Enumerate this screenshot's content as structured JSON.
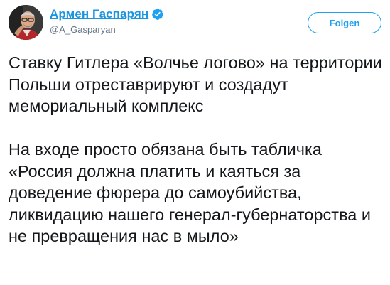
{
  "user": {
    "display_name": "Армен Гаспарян",
    "handle": "@A_Gasparyan",
    "verified": true,
    "avatar_icon": "profile-avatar-icon",
    "verified_icon": "verified-badge-icon"
  },
  "actions": {
    "follow_label": "Folgen"
  },
  "tweet": {
    "paragraphs": [
      "Ставку Гитлера «Волчье логово» на территории Польши отреставрируют и создадут мемориальный комплекс",
      "На входе просто обязана быть табличка «Россия должна платить и каяться за доведение фюрера до самоубийства, ликвидацию нашего генерал-губернаторства и не превращения нас в мыло»"
    ]
  },
  "colors": {
    "accent": "#1da1f2",
    "name_link": "#1b95e0",
    "text": "#14171a",
    "secondary_text": "#657786"
  }
}
